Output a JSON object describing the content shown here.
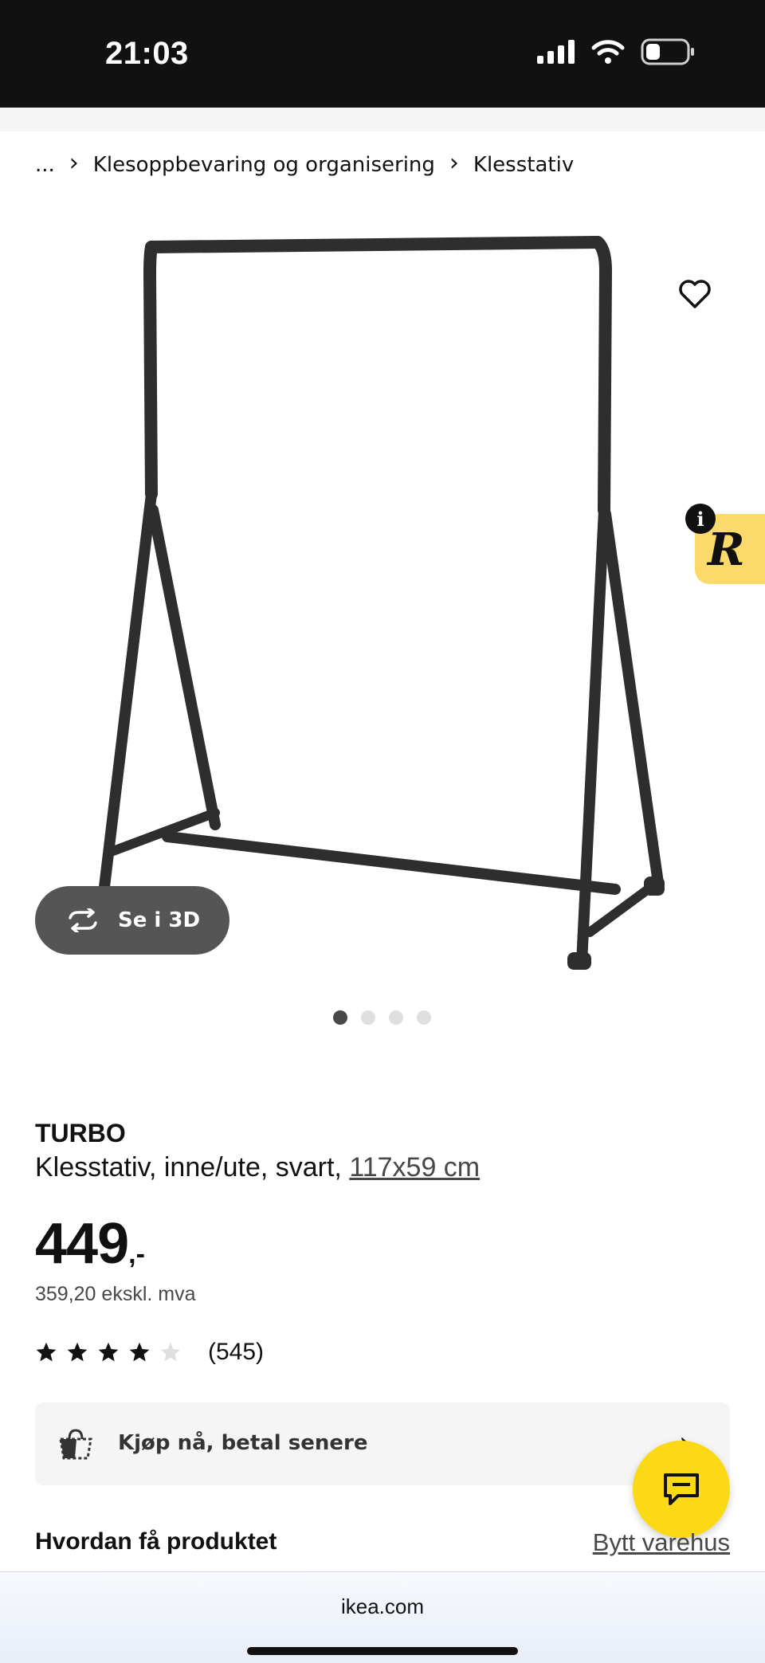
{
  "status_bar": {
    "time": "21:03",
    "icons": [
      "signal-icon",
      "wifi-icon",
      "battery-icon"
    ]
  },
  "breadcrumb": {
    "items": [
      "...",
      "Klesoppbevaring og organisering",
      "Klesstativ"
    ],
    "separator": "›"
  },
  "product_image": {
    "see_3d_label": "Se i 3D",
    "dots_total": 4,
    "dots_active_index": 0
  },
  "product": {
    "name": "TURBO",
    "description": "Klesstativ, inne/ute, svart, ",
    "size": "117x59 cm",
    "price": "449",
    "price_suffix": ",-",
    "price_ex_vat": "359,20 ekskl. mva",
    "rating_stars": 4,
    "rating_max": 5,
    "review_count": "(545)"
  },
  "bnpl": {
    "label": "Kjøp nå, betal senere",
    "chevron": "›"
  },
  "delivery": {
    "title": "Hvordan få produktet",
    "change_store": "Bytt varehus"
  },
  "badges": {
    "r_letter": "R",
    "info_letter": "i"
  },
  "browser": {
    "url": "ikea.com"
  },
  "colors": {
    "status_bar_bg": "#111111",
    "chat_button": "#fbd914",
    "r_badge": "#fbd96b",
    "see_3d_bg": "#555555",
    "card_bg": "#f5f5f5"
  }
}
